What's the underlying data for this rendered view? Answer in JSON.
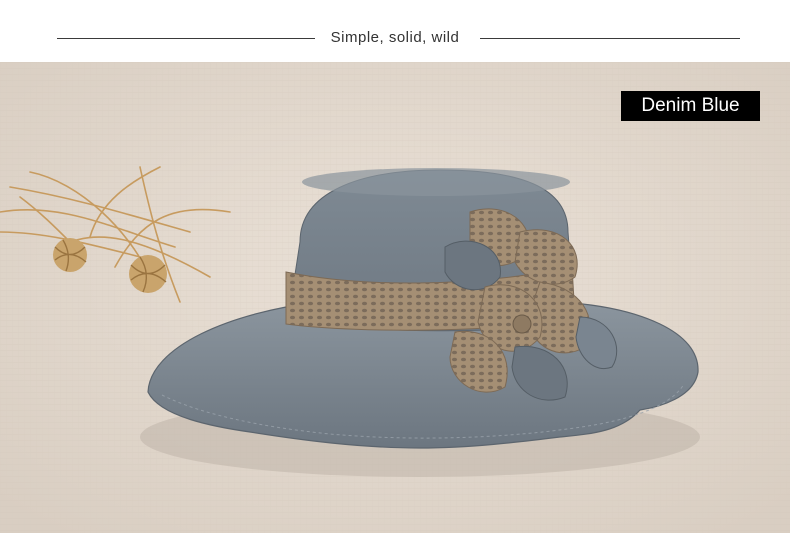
{
  "header": {
    "tagline": "Simple, solid, wild"
  },
  "product": {
    "color_label": "Denim Blue"
  },
  "colors": {
    "hat": "#7a8590",
    "lace": "#a58f74",
    "background": "#e2d8cd"
  }
}
